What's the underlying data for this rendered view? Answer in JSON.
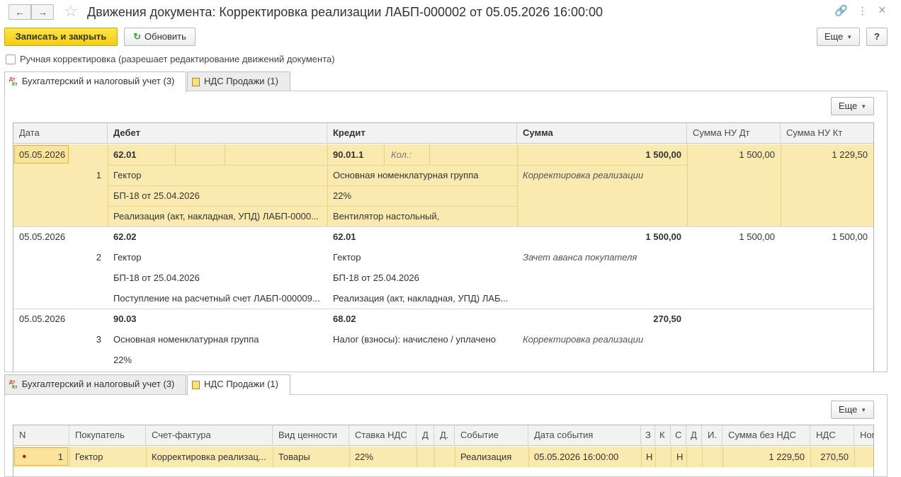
{
  "window": {
    "title": "Движения документа: Корректировка реализации ЛАБП-000002 от 05.05.2026 16:00:00",
    "nav_back": "←",
    "nav_forward": "→",
    "star": "☆",
    "link_icon": "🔗",
    "menu_icon": "⋮",
    "close_icon": "×"
  },
  "toolbar": {
    "save_close": "Записать и закрыть",
    "refresh_icon": "↻",
    "refresh": "Обновить",
    "more": "Еще",
    "help": "?"
  },
  "manual_correction": {
    "label": "Ручная корректировка (разрешает редактирование движений документа)",
    "checked": false
  },
  "tabs": [
    {
      "label": "Бухгалтерский и налоговый учет (3)",
      "icon_dt": "Дт",
      "icon_kt": "Кт"
    },
    {
      "label": "НДС Продажи (1)"
    }
  ],
  "accounting_table": {
    "more": "Еще",
    "columns": [
      "Дата",
      "Дебет",
      "Кредит",
      "Сумма",
      "Сумма НУ Дт",
      "Сумма НУ Кт"
    ],
    "rows": [
      {
        "date": "05.05.2026",
        "n": "1",
        "debit_account": "62.01",
        "debit_lines": [
          "Гектор",
          "БП-18 от 25.04.2026",
          "Реализация (акт, накладная, УПД) ЛАБП-0000..."
        ],
        "credit_account": "90.01.1",
        "credit_qty_label": "Кол.:",
        "credit_lines": [
          "Основная номенклатурная группа",
          "22%",
          "Вентилятор настольный,"
        ],
        "sum": "1 500,00",
        "content": "Корректировка реализации",
        "sum_nu_dt": "1 500,00",
        "sum_nu_kt": "1 229,50"
      },
      {
        "date": "05.05.2026",
        "n": "2",
        "debit_account": "62.02",
        "debit_lines": [
          "Гектор",
          "БП-18 от 25.04.2026",
          "Поступление на расчетный счет ЛАБП-000009..."
        ],
        "credit_account": "62.01",
        "credit_lines": [
          "Гектор",
          "БП-18 от 25.04.2026",
          "Реализация (акт, накладная, УПД) ЛАБ..."
        ],
        "sum": "1 500,00",
        "content": "Зачет аванса покупателя",
        "sum_nu_dt": "1 500,00",
        "sum_nu_kt": "1 500,00"
      },
      {
        "date": "05.05.2026",
        "n": "3",
        "debit_account": "90.03",
        "debit_lines": [
          "Основная номенклатурная группа",
          "22%"
        ],
        "credit_account": "68.02",
        "credit_lines": [
          "Налог (взносы): начислено / уплачено"
        ],
        "sum": "270,50",
        "content": "Корректировка реализации"
      }
    ]
  },
  "vat_table": {
    "more": "Еще",
    "columns": [
      "N",
      "Покупатель",
      "Счет-фактура",
      "Вид ценности",
      "Ставка НДС",
      "Д",
      "Д.",
      "Событие",
      "Дата события",
      "З",
      "К",
      "С",
      "Д",
      "И.",
      "Сумма без НДС",
      "НДС",
      "Ном"
    ],
    "rows": [
      {
        "n": "1",
        "buyer": "Гектор",
        "invoice": "Корректировка реализац...",
        "value_type": "Товары",
        "vat_rate": "22%",
        "event": "Реализация",
        "event_date": "05.05.2026 16:00:00",
        "c_z": "Н",
        "c_s": "Н",
        "sum_without_vat": "1 229,50",
        "vat": "270,50"
      }
    ]
  },
  "colors": {
    "accent_yellow": "#f5d21c",
    "selection": "#fbeab0"
  }
}
